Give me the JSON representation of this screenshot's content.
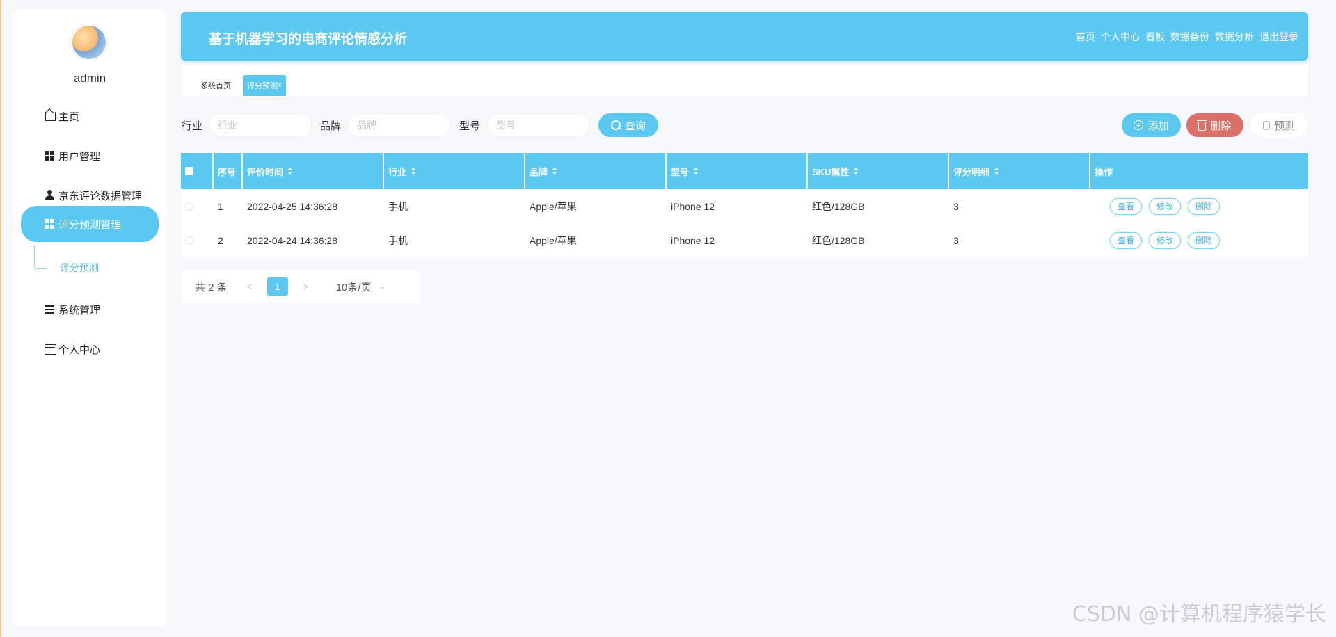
{
  "user": {
    "name": "admin"
  },
  "sidebar": {
    "items": [
      {
        "label": "主页",
        "icon": "home-icon"
      },
      {
        "label": "用户管理",
        "icon": "grid-icon"
      },
      {
        "label": "京东评论数据管理",
        "icon": "user-icon"
      },
      {
        "label": "评分预测管理",
        "icon": "grid-icon"
      },
      {
        "label": "系统管理",
        "icon": "list-icon"
      },
      {
        "label": "个人中心",
        "icon": "card-icon"
      }
    ],
    "submenu": {
      "label": "评分预测"
    }
  },
  "header": {
    "title": "基于机器学习的电商评论情感分析",
    "nav": [
      "首页",
      "个人中心",
      "看板",
      "数据备份",
      "数据分析",
      "退出登录"
    ]
  },
  "tabs": {
    "home": "系统首页",
    "active": "评分预测",
    "close": "×"
  },
  "filters": [
    {
      "label": "行业",
      "placeholder": "行业"
    },
    {
      "label": "品牌",
      "placeholder": "品牌"
    },
    {
      "label": "型号",
      "placeholder": "型号"
    }
  ],
  "buttons": {
    "query": "查询",
    "add": "添加",
    "delete": "删除",
    "predict": "预测"
  },
  "table": {
    "headers": [
      "序号",
      "评价时间",
      "行业",
      "品牌",
      "型号",
      "SKU属性",
      "评分明细",
      "操作"
    ],
    "rows": [
      {
        "index": "1",
        "time": "2022-04-25 14:36:28",
        "industry": "手机",
        "brand": "Apple/苹果",
        "model": "iPhone 12",
        "sku": "红色/128GB",
        "score": "3"
      },
      {
        "index": "2",
        "time": "2022-04-24 14:36:28",
        "industry": "手机",
        "brand": "Apple/苹果",
        "model": "iPhone 12",
        "sku": "红色/128GB",
        "score": "3"
      }
    ],
    "actions": {
      "view": "查看",
      "edit": "修改",
      "delete": "删除"
    }
  },
  "pagination": {
    "total": "共 2 条",
    "prev": "<",
    "page": "1",
    "next": ">",
    "size": "10条/页",
    "size_arrow": "⌄"
  },
  "watermark": "CSDN @计算机程序猿学长",
  "colors": {
    "primary": "#5bc8f2",
    "danger": "#d9706a",
    "background": "#f7f8fc"
  }
}
